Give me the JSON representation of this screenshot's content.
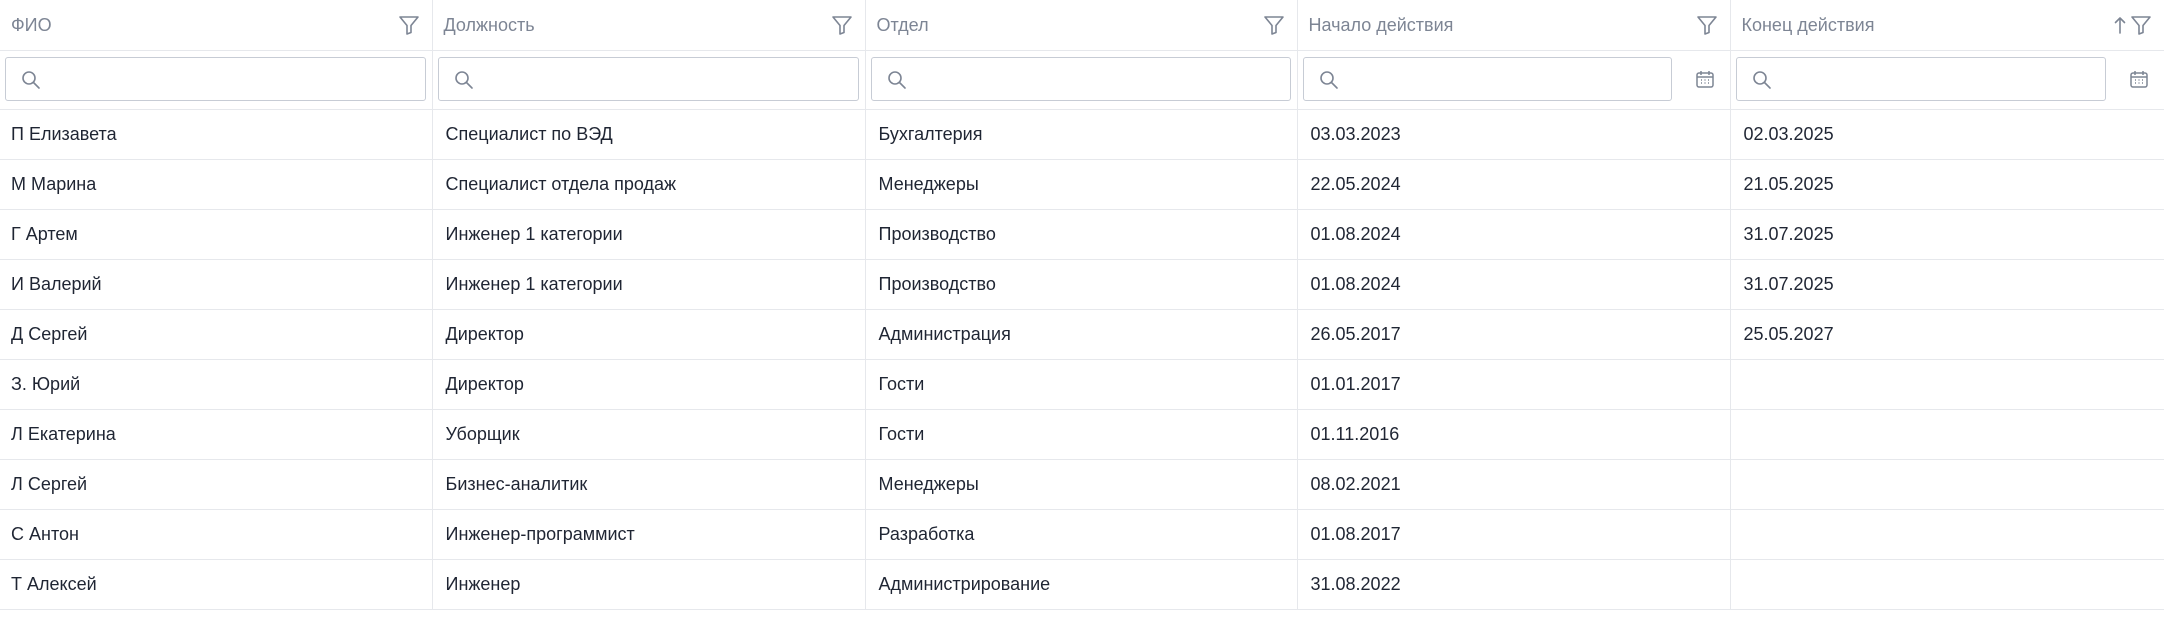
{
  "columns": [
    {
      "label": "ФИО",
      "icon": "filter-icon"
    },
    {
      "label": "Должность",
      "icon": "filter-icon"
    },
    {
      "label": "Отдел",
      "icon": "filter-icon"
    },
    {
      "label": "Начало действия",
      "icon": "filter-icon"
    },
    {
      "label": "Конец действия",
      "icon": "filter-icon",
      "sort": "sort-ascending-icon"
    }
  ],
  "filters": [
    {
      "value": "",
      "icon": "search-icon"
    },
    {
      "value": "",
      "icon": "search-icon"
    },
    {
      "value": "",
      "icon": "search-icon"
    },
    {
      "value": "",
      "icon": "search-icon",
      "extra": "calendar-icon"
    },
    {
      "value": "",
      "icon": "search-icon",
      "extra": "calendar-icon"
    }
  ],
  "rows": [
    [
      "П Елизавета",
      "Специалист по ВЭД",
      "Бухгалтерия",
      "03.03.2023",
      "02.03.2025"
    ],
    [
      "М Марина",
      "Специалист отдела продаж",
      "Менеджеры",
      "22.05.2024",
      "21.05.2025"
    ],
    [
      "Г Артем",
      "Инженер 1 категории",
      "Производство",
      "01.08.2024",
      "31.07.2025"
    ],
    [
      "И Валерий",
      "Инженер 1 категории",
      "Производство",
      "01.08.2024",
      "31.07.2025"
    ],
    [
      "Д Сергей",
      "Директор",
      "Администрация",
      "26.05.2017",
      "25.05.2027"
    ],
    [
      "З. Юрий",
      "Директор",
      "Гости",
      "01.01.2017",
      ""
    ],
    [
      "Л Екатерина",
      "Уборщик",
      "Гости",
      "01.11.2016",
      ""
    ],
    [
      "Л Сергей",
      "Бизнес-аналитик",
      "Менеджеры",
      "08.02.2021",
      ""
    ],
    [
      "С Антон",
      "Инженер-программист",
      "Разработка",
      "01.08.2017",
      ""
    ],
    [
      "Т Алексей",
      "Инженер",
      "Администрирование",
      "31.08.2022",
      ""
    ]
  ],
  "colors": {
    "border": "#e6e8ec",
    "header_text": "#7d8594",
    "text": "#1f2533",
    "input_border": "#c7ccd5"
  }
}
